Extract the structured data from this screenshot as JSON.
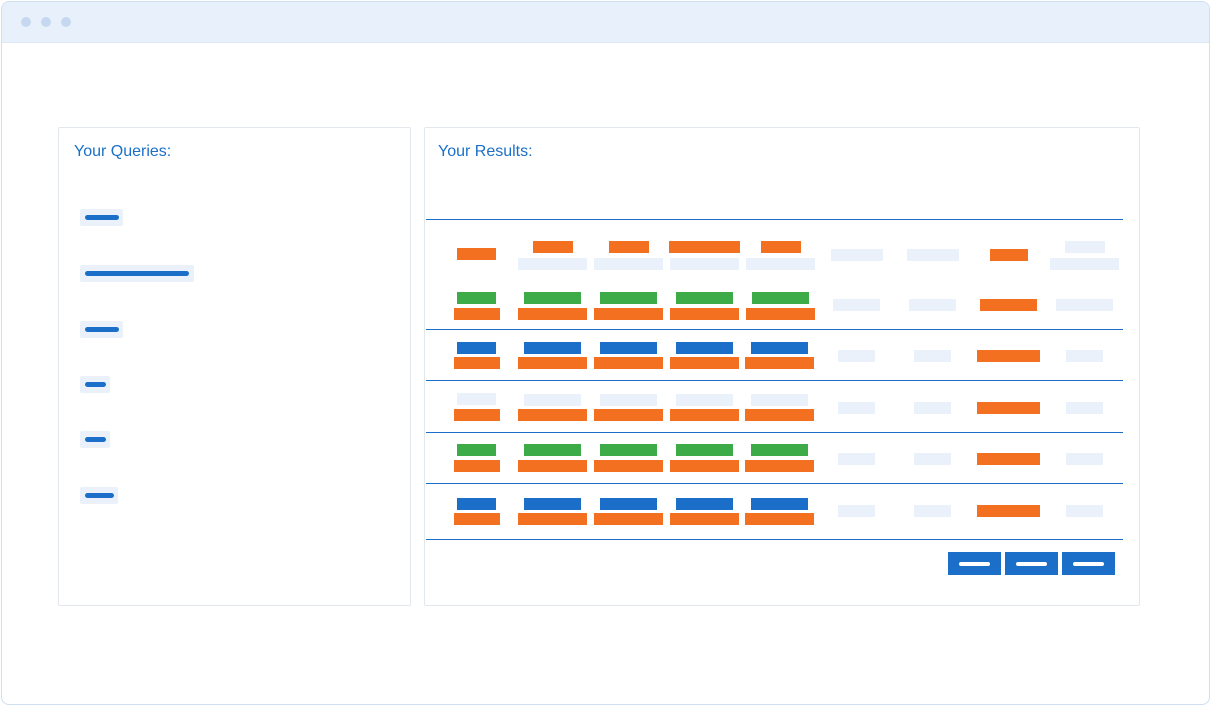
{
  "window": {
    "controls": [
      "close",
      "minimize",
      "maximize"
    ]
  },
  "queries_panel": {
    "title": "Your Queries:",
    "query_count": 6
  },
  "results_panel": {
    "title": "Your Results:",
    "row_count": 6
  },
  "pagination": {
    "button_count": 3
  },
  "colors": {
    "accent": "#1b6fc8",
    "orange": "#f47021",
    "green": "#3dab47",
    "placeholder": "#eaf1fa",
    "titlebar": "#e8f0fb"
  }
}
